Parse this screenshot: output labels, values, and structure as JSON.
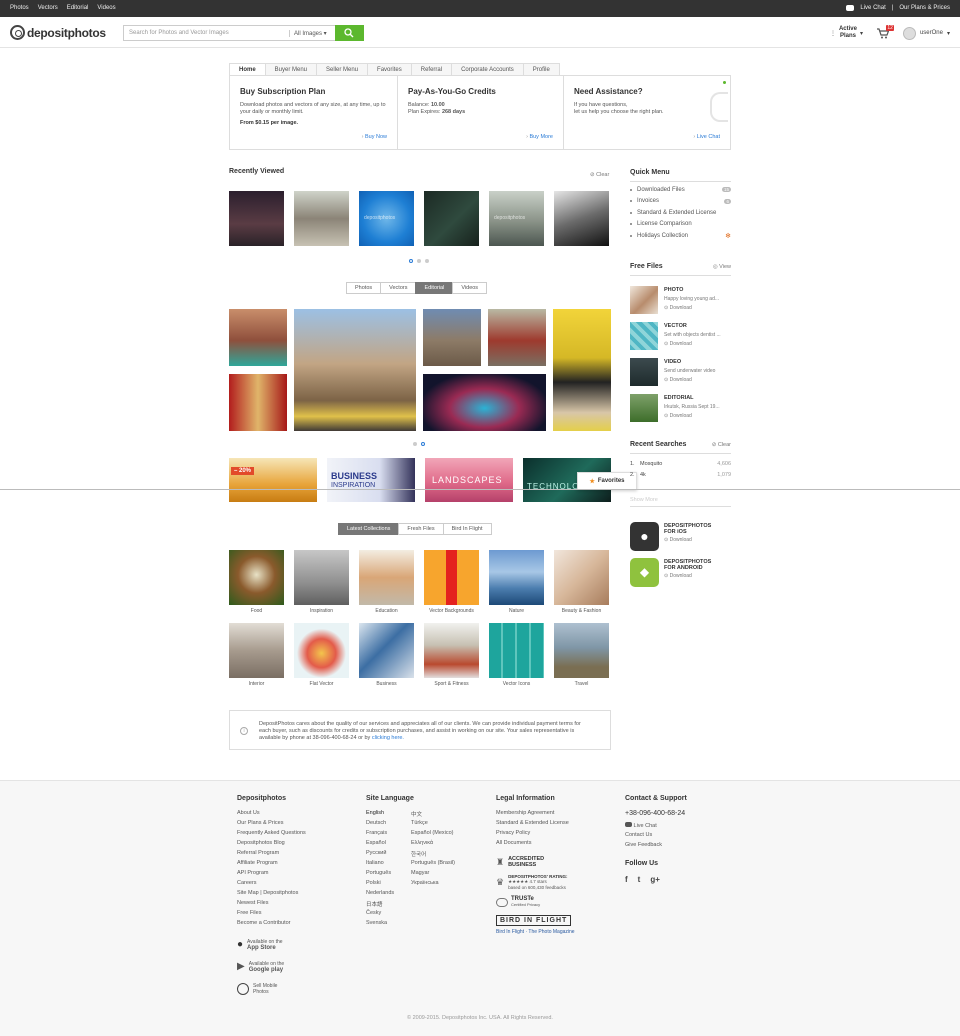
{
  "topbar": {
    "nav": [
      "Photos",
      "Vectors",
      "Editorial",
      "Videos"
    ],
    "live_chat": "Live Chat",
    "separator": "|",
    "plans_prices": "Our Plans & Prices"
  },
  "header": {
    "logo_text": "depositphotos",
    "search_placeholder": "Search for Photos and Vector Images",
    "search_scope": "All Images",
    "active_plans_line1": "Active",
    "active_plans_line2": "Plans",
    "cart_count": "12",
    "username": "userOne"
  },
  "account_tabs": [
    "Home",
    "Buyer Menu",
    "Seller Menu",
    "Favorites",
    "Referral",
    "Corporate Accounts",
    "Profile"
  ],
  "panel": {
    "subscription": {
      "title": "Buy Subscription Plan",
      "text": "Download photos and vectors of any size, at any time, up to your daily or monthly limit.",
      "price": "From $0.15 per image.",
      "action": "Buy Now"
    },
    "credits": {
      "title": "Pay-As-You-Go Credits",
      "balance_label": "Balance:",
      "balance_value": "10.00",
      "expires_label": "Plan Expires:",
      "expires_value": "268 days",
      "action": "Buy More"
    },
    "assistance": {
      "title": "Need Assistance?",
      "line1": "If you have questions,",
      "line2": "let us help you choose the right plan.",
      "action": "Live Chat"
    }
  },
  "recently_viewed": {
    "title": "Recently Viewed",
    "clear": "Clear",
    "watermark": "depositphotos"
  },
  "media_tabs": [
    "Photos",
    "Vectors",
    "Editorial",
    "Videos"
  ],
  "banners": {
    "discount": "– 20%",
    "business": "BUSINESS",
    "inspiration": "INSPIRATION",
    "landscapes": "LANDSCAPES",
    "technology": "TECHNOLOGY",
    "favorites": "Favorites"
  },
  "collection_tabs": [
    "Latest Collections",
    "Fresh Files",
    "Bird In Flight"
  ],
  "collections": [
    "Food",
    "Inspiration",
    "Education",
    "Vector Backgrounds",
    "Nature",
    "Beauty & Fashion",
    "Interior",
    "Flat Vector",
    "Business",
    "Sport & Fitness",
    "Vector Icons",
    "Travel"
  ],
  "info": {
    "text": "DepositPhotos cares about the quality of our services and appreciates all of our clients. We can provide individual payment terms for each buyer, such as discounts for credits or subscription purchases, and assist in working on our site. Your sales representative is available by phone at 38-096-400-68-24 or by",
    "link": "clicking here."
  },
  "quick_menu": {
    "title": "Quick Menu",
    "items": [
      {
        "label": "Downloaded Files",
        "count": "15"
      },
      {
        "label": "Invoices",
        "count": "6"
      },
      {
        "label": "Standard & Extended License",
        "count": ""
      },
      {
        "label": "License Comparison",
        "count": ""
      },
      {
        "label": "Holidays Collection",
        "count": ""
      }
    ]
  },
  "free_files": {
    "title": "Free Files",
    "view": "View",
    "items": [
      {
        "type": "PHOTO",
        "desc": "Happy loving young ad...",
        "action": "Download"
      },
      {
        "type": "VECTOR",
        "desc": "Set with objects dentist ...",
        "action": "Download"
      },
      {
        "type": "VIDEO",
        "desc": "Send underwater video",
        "action": "Download"
      },
      {
        "type": "EDITORIAL",
        "desc": "Irkutsk, Russia Sept 19...",
        "action": "Download"
      }
    ]
  },
  "recent_searches": {
    "title": "Recent Searches",
    "clear": "Clear",
    "items": [
      {
        "num": "1.",
        "term": "Mosquito",
        "count": "4,606"
      },
      {
        "num": "2.",
        "term": "4k",
        "count": "1,079"
      }
    ],
    "more": "Show More"
  },
  "apps": [
    {
      "line1": "DEPOSITPHOTOS",
      "line2": "FOR iOS",
      "action": "Download"
    },
    {
      "line1": "DEPOSITPHOTOS",
      "line2": "FOR ANDROID",
      "action": "Download"
    }
  ],
  "footer": {
    "company": {
      "title": "Depositphotos",
      "links": [
        "About Us",
        "Our Plans & Prices",
        "Frequently Asked Questions",
        "Depositphotos Blog",
        "Referral Program",
        "Affiliate Program",
        "API Program",
        "Careers",
        "Site Map | Depositphotos",
        "Newest Files",
        "Free Files",
        "Become a Contributor"
      ],
      "appstore_small": "Available on the",
      "appstore": "App Store",
      "googleplay_small": "Available on the",
      "googleplay": "Google play",
      "sell_line1": "Sell Mobile",
      "sell_line2": "Photos"
    },
    "languages": {
      "title": "Site Language",
      "col1": [
        "English",
        "Deutsch",
        "Français",
        "Español",
        "Русский",
        "Italiano",
        "Português",
        "Polski",
        "Nederlands",
        "日本語",
        "Česky",
        "Svenska"
      ],
      "col2": [
        "中文",
        "Türkçe",
        "Español (Mexico)",
        "Ελληνικά",
        "한국어",
        "Português (Brasil)",
        "Magyar",
        "Українська"
      ]
    },
    "legal": {
      "title": "Legal Information",
      "links": [
        "Membership Agreement",
        "Standard & Extended License",
        "Privacy Policy",
        "All Documents"
      ],
      "accredited_line1": "ACCREDITED",
      "accredited_line2": "BUSINESS",
      "rating_title": "DEPOSITPHOTOS' RATING:",
      "rating_stars": "★★★★★",
      "rating_value": "4.7 stars",
      "rating_based": "based on 600,430 feedbacks",
      "truste": "TRUSTe",
      "truste_sub": "Certified Privacy",
      "bird": "BIRD IN FLIGHT",
      "bird_caption": "Bird In Flight · The Photo Magazine"
    },
    "contact": {
      "title": "Contact & Support",
      "phone": "+38-096-400-68-24",
      "live_chat": "Live Chat",
      "contact_us": "Contact Us",
      "feedback": "Give Feedback",
      "follow": "Follow Us",
      "social": [
        "f",
        "t",
        "g+"
      ]
    },
    "copyright": "© 2009-2015. Depositphotos Inc. USA. All Rights Reserved."
  },
  "colors": {
    "accent_green": "#5cb82e",
    "link_blue": "#2a7bd6",
    "topbar": "#333333"
  }
}
